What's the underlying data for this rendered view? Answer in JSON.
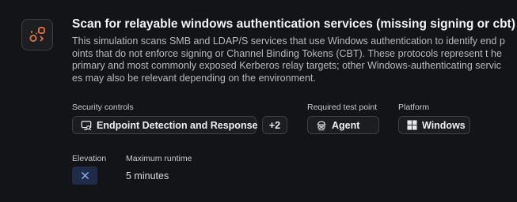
{
  "scenario": {
    "title": "Scan for relayable windows authentication services (missing signing or cbt)",
    "description": "This simulation scans SMB and LDAP/S services that use Windows authentication to identify end points that do not enforce signing or Channel Binding Tokens (CBT). These protocols represent t he primary and most commonly exposed Kerberos relay targets; other Windows-authenticating services may also be relevant depending on the environment.",
    "icon": "relay-nodes-icon"
  },
  "security_controls": {
    "label": "Security controls",
    "primary": "Endpoint Detection and Response",
    "primary_icon": "monitor-search-icon",
    "more": "+2"
  },
  "test_point": {
    "label": "Required test point",
    "value": "Agent",
    "icon": "agent-icon"
  },
  "platform": {
    "label": "Platform",
    "value": "Windows",
    "icon": "windows-logo-icon"
  },
  "elevation": {
    "label": "Elevation",
    "icon": "x-icon",
    "state": "not required"
  },
  "runtime": {
    "label": "Maximum runtime",
    "value": "5 minutes"
  },
  "colors": {
    "background": "#131417",
    "accent": "#e8743b",
    "elevation_bg": "#1f2c47",
    "elevation_x": "#8fb1ff"
  }
}
